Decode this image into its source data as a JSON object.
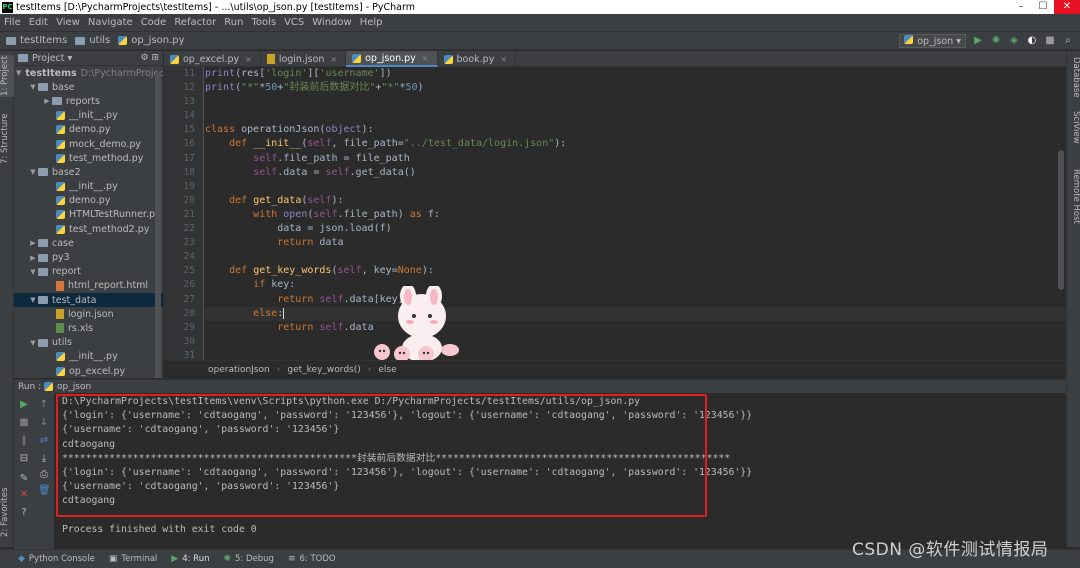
{
  "window": {
    "title": "testItems [D:\\PycharmProjects\\testItems] - ...\\utils\\op_json.py [testItems] - PyCharm"
  },
  "menu": [
    "File",
    "Edit",
    "View",
    "Navigate",
    "Code",
    "Refactor",
    "Run",
    "Tools",
    "VCS",
    "Window",
    "Help"
  ],
  "navbar": {
    "crumbs": [
      "testItems",
      "utils",
      "op_json.py"
    ],
    "run_config": "op_json"
  },
  "left_tabs": [
    "1: Project",
    "7: Structure",
    "2: Favorites"
  ],
  "right_tabs": [
    "Database",
    "SciView",
    "Remote Host"
  ],
  "project": {
    "header": "Project",
    "root_name": "testItems",
    "root_path": "D:\\PycharmProjects",
    "items": [
      {
        "label": "base",
        "type": "folder",
        "depth": 1,
        "expanded": true
      },
      {
        "label": "reports",
        "type": "folder",
        "depth": 2,
        "expanded": false
      },
      {
        "label": "__init__.py",
        "type": "py",
        "depth": 3
      },
      {
        "label": "demo.py",
        "type": "py",
        "depth": 3
      },
      {
        "label": "mock_demo.py",
        "type": "py",
        "depth": 3
      },
      {
        "label": "test_method.py",
        "type": "py",
        "depth": 3
      },
      {
        "label": "base2",
        "type": "folder",
        "depth": 1,
        "expanded": true
      },
      {
        "label": "__init__.py",
        "type": "py",
        "depth": 3
      },
      {
        "label": "demo.py",
        "type": "py",
        "depth": 3
      },
      {
        "label": "HTMLTestRunner.py",
        "type": "py",
        "depth": 3
      },
      {
        "label": "test_method2.py",
        "type": "py",
        "depth": 3
      },
      {
        "label": "case",
        "type": "folder",
        "depth": 1,
        "expanded": false
      },
      {
        "label": "py3",
        "type": "folder",
        "depth": 1,
        "expanded": false
      },
      {
        "label": "report",
        "type": "folder",
        "depth": 1,
        "expanded": true
      },
      {
        "label": "html_report.html",
        "type": "html",
        "depth": 3
      },
      {
        "label": "test_data",
        "type": "folder",
        "depth": 1,
        "expanded": true,
        "selected": true
      },
      {
        "label": "login.json",
        "type": "json",
        "depth": 3
      },
      {
        "label": "rs.xls",
        "type": "xls",
        "depth": 3
      },
      {
        "label": "utils",
        "type": "folder",
        "depth": 1,
        "expanded": true
      },
      {
        "label": "__init__.py",
        "type": "py",
        "depth": 3
      },
      {
        "label": "op_excel.py",
        "type": "py",
        "depth": 3
      }
    ]
  },
  "editor_tabs": [
    {
      "label": "op_excel.py",
      "icon": "py",
      "active": false
    },
    {
      "label": "login.json",
      "icon": "json",
      "active": false
    },
    {
      "label": "op_json.py",
      "icon": "py",
      "active": true
    },
    {
      "label": "book.py",
      "icon": "py",
      "active": false
    }
  ],
  "code": {
    "line_numbers": [
      "11",
      "12",
      "13",
      "14",
      "15",
      "16",
      "17",
      "18",
      "19",
      "20",
      "21",
      "22",
      "23",
      "24",
      "25",
      "26",
      "27",
      "28",
      "29",
      "30",
      "31"
    ],
    "lines": [
      [
        [
          "print",
          "bi"
        ],
        [
          "(res[",
          ""
        ],
        [
          "'login'",
          "st"
        ],
        [
          "][",
          ""
        ],
        [
          "'username'",
          "st"
        ],
        [
          "])",
          ""
        ]
      ],
      [
        [
          "print",
          "bi"
        ],
        [
          "(",
          ""
        ],
        [
          "\"*\"",
          "st"
        ],
        [
          "*",
          ""
        ],
        [
          "50",
          "nm"
        ],
        [
          "+",
          ""
        ],
        [
          "\"封装前后数据对比\"",
          "st"
        ],
        [
          "+",
          ""
        ],
        [
          "\"*\"",
          "st"
        ],
        [
          "*",
          ""
        ],
        [
          "50",
          "nm"
        ],
        [
          ")",
          ""
        ]
      ],
      [],
      [],
      [
        [
          "class ",
          "kw"
        ],
        [
          "operationJson(",
          ""
        ],
        [
          "object",
          "bi"
        ],
        [
          "):",
          ""
        ]
      ],
      [
        [
          "    ",
          ""
        ],
        [
          "def ",
          "kw"
        ],
        [
          "__init__",
          "fn"
        ],
        [
          "(",
          ""
        ],
        [
          "self",
          "sf"
        ],
        [
          ", file_path=",
          ""
        ],
        [
          "\"../test_data/login.json\"",
          "st"
        ],
        [
          "):",
          ""
        ]
      ],
      [
        [
          "        ",
          ""
        ],
        [
          "self",
          "sf"
        ],
        [
          ".file_path = file_path",
          ""
        ]
      ],
      [
        [
          "        ",
          ""
        ],
        [
          "self",
          "sf"
        ],
        [
          ".data = ",
          ""
        ],
        [
          "self",
          "sf"
        ],
        [
          ".get_data()",
          ""
        ]
      ],
      [],
      [
        [
          "    ",
          ""
        ],
        [
          "def ",
          "kw"
        ],
        [
          "get_data",
          "fn"
        ],
        [
          "(",
          ""
        ],
        [
          "self",
          "sf"
        ],
        [
          "):",
          ""
        ]
      ],
      [
        [
          "        ",
          ""
        ],
        [
          "with ",
          "kw"
        ],
        [
          "open",
          "bi"
        ],
        [
          "(",
          ""
        ],
        [
          "self",
          "sf"
        ],
        [
          ".file_path) ",
          ""
        ],
        [
          "as ",
          "kw"
        ],
        [
          "f:",
          ""
        ]
      ],
      [
        [
          "            data = json.load(f)",
          ""
        ]
      ],
      [
        [
          "            ",
          ""
        ],
        [
          "return ",
          "kw"
        ],
        [
          "data",
          ""
        ]
      ],
      [],
      [
        [
          "    ",
          ""
        ],
        [
          "def ",
          "kw"
        ],
        [
          "get_key_words",
          "fn"
        ],
        [
          "(",
          ""
        ],
        [
          "self",
          "sf"
        ],
        [
          ", key=",
          ""
        ],
        [
          "None",
          "kw"
        ],
        [
          "):",
          ""
        ]
      ],
      [
        [
          "        ",
          ""
        ],
        [
          "if ",
          "kw"
        ],
        [
          "key:",
          ""
        ]
      ],
      [
        [
          "            ",
          ""
        ],
        [
          "return ",
          "kw"
        ],
        [
          "self",
          "sf"
        ],
        [
          ".data[key]",
          ""
        ]
      ],
      [
        [
          "        ",
          ""
        ],
        [
          "else",
          "kw"
        ],
        [
          ":",
          ""
        ]
      ],
      [
        [
          "            ",
          ""
        ],
        [
          "return ",
          "kw"
        ],
        [
          "self",
          "sf"
        ],
        [
          ".data",
          ""
        ]
      ],
      [],
      []
    ]
  },
  "editor_breadcrumb": [
    "operationJson",
    "get_key_words()",
    "else"
  ],
  "run_panel": {
    "label": "Run",
    "config": "op_json",
    "output": [
      "D:\\PycharmProjects\\testItems\\venv\\Scripts\\python.exe D:/PycharmProjects/testItems/utils/op_json.py",
      "{'login': {'username': 'cdtaogang', 'password': '123456'}, 'logout': {'username': 'cdtaogang', 'password': '123456'}}",
      "{'username': 'cdtaogang', 'password': '123456'}",
      "cdtaogang",
      "**************************************************封装前后数据对比**************************************************",
      "{'login': {'username': 'cdtaogang', 'password': '123456'}, 'logout': {'username': 'cdtaogang', 'password': '123456'}}",
      "{'username': 'cdtaogang', 'password': '123456'}",
      "cdtaogang",
      "",
      "Process finished with exit code 0"
    ]
  },
  "statusbar": {
    "items": [
      "Python Console",
      "Terminal",
      "4: Run",
      "5: Debug",
      "6: TODO"
    ]
  },
  "watermark": "CSDN @软件测试情报局",
  "colors": {
    "highlight_box": "#e02020",
    "selection": "#0d293e",
    "accent_tab": "#4a88c7"
  }
}
